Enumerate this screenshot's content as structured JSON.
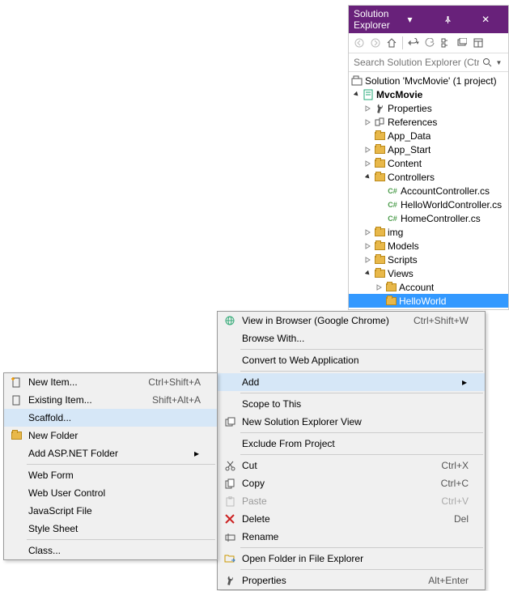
{
  "panel": {
    "title": "Solution Explorer",
    "search_placeholder": "Search Solution Explorer (Ctrl+;)"
  },
  "tree": {
    "solution": "Solution 'MvcMovie' (1 project)",
    "project": "MvcMovie",
    "nodes": {
      "properties": "Properties",
      "references": "References",
      "app_data": "App_Data",
      "app_start": "App_Start",
      "content": "Content",
      "controllers": "Controllers",
      "account_ctrl": "AccountController.cs",
      "hello_ctrl": "HelloWorldController.cs",
      "home_ctrl": "HomeController.cs",
      "img": "img",
      "models": "Models",
      "scripts": "Scripts",
      "views": "Views",
      "account": "Account",
      "helloworld": "HelloWorld"
    }
  },
  "menu": {
    "view_browser": "View in Browser (Google Chrome)",
    "view_browser_key": "Ctrl+Shift+W",
    "browse_with": "Browse With...",
    "convert": "Convert to Web Application",
    "add": "Add",
    "scope": "Scope to This",
    "new_view": "New Solution Explorer View",
    "exclude": "Exclude From Project",
    "cut": "Cut",
    "cut_key": "Ctrl+X",
    "copy": "Copy",
    "copy_key": "Ctrl+C",
    "paste": "Paste",
    "paste_key": "Ctrl+V",
    "delete": "Delete",
    "delete_key": "Del",
    "rename": "Rename",
    "open_folder": "Open Folder in File Explorer",
    "properties": "Properties",
    "properties_key": "Alt+Enter"
  },
  "submenu": {
    "new_item": "New Item...",
    "new_item_key": "Ctrl+Shift+A",
    "existing_item": "Existing Item...",
    "existing_item_key": "Shift+Alt+A",
    "scaffold": "Scaffold...",
    "new_folder": "New Folder",
    "asp_folder": "Add ASP.NET Folder",
    "web_form": "Web Form",
    "web_user": "Web User Control",
    "js_file": "JavaScript File",
    "style_sheet": "Style Sheet",
    "class": "Class..."
  }
}
